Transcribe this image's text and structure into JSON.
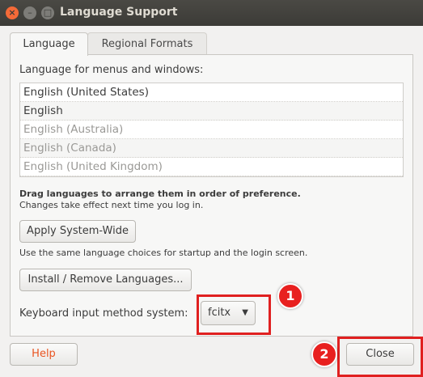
{
  "window": {
    "title": "Language Support",
    "close_glyph": "×",
    "min_glyph": "–",
    "max_glyph": "□"
  },
  "tabs": [
    {
      "label": "Language"
    },
    {
      "label": "Regional Formats"
    }
  ],
  "language_section": {
    "heading": "Language for menus and windows:",
    "languages": [
      "English (United States)",
      "English",
      "English (Australia)",
      "English (Canada)",
      "English (United Kingdom)"
    ],
    "drag_hint": "Drag languages to arrange them in order of preference.",
    "effect_hint": "Changes take effect next time you log in."
  },
  "apply_button": "Apply System-Wide",
  "apply_hint": "Use the same language choices for startup and the login screen.",
  "install_button": "Install / Remove Languages...",
  "input_method": {
    "label": "Keyboard input method system:",
    "value": "fcitx",
    "arrow_glyph": "▼"
  },
  "footer": {
    "help_label": "Help",
    "close_label": "Close"
  },
  "annotations": {
    "marker1": "1",
    "marker2": "2",
    "color": "#e02020"
  }
}
